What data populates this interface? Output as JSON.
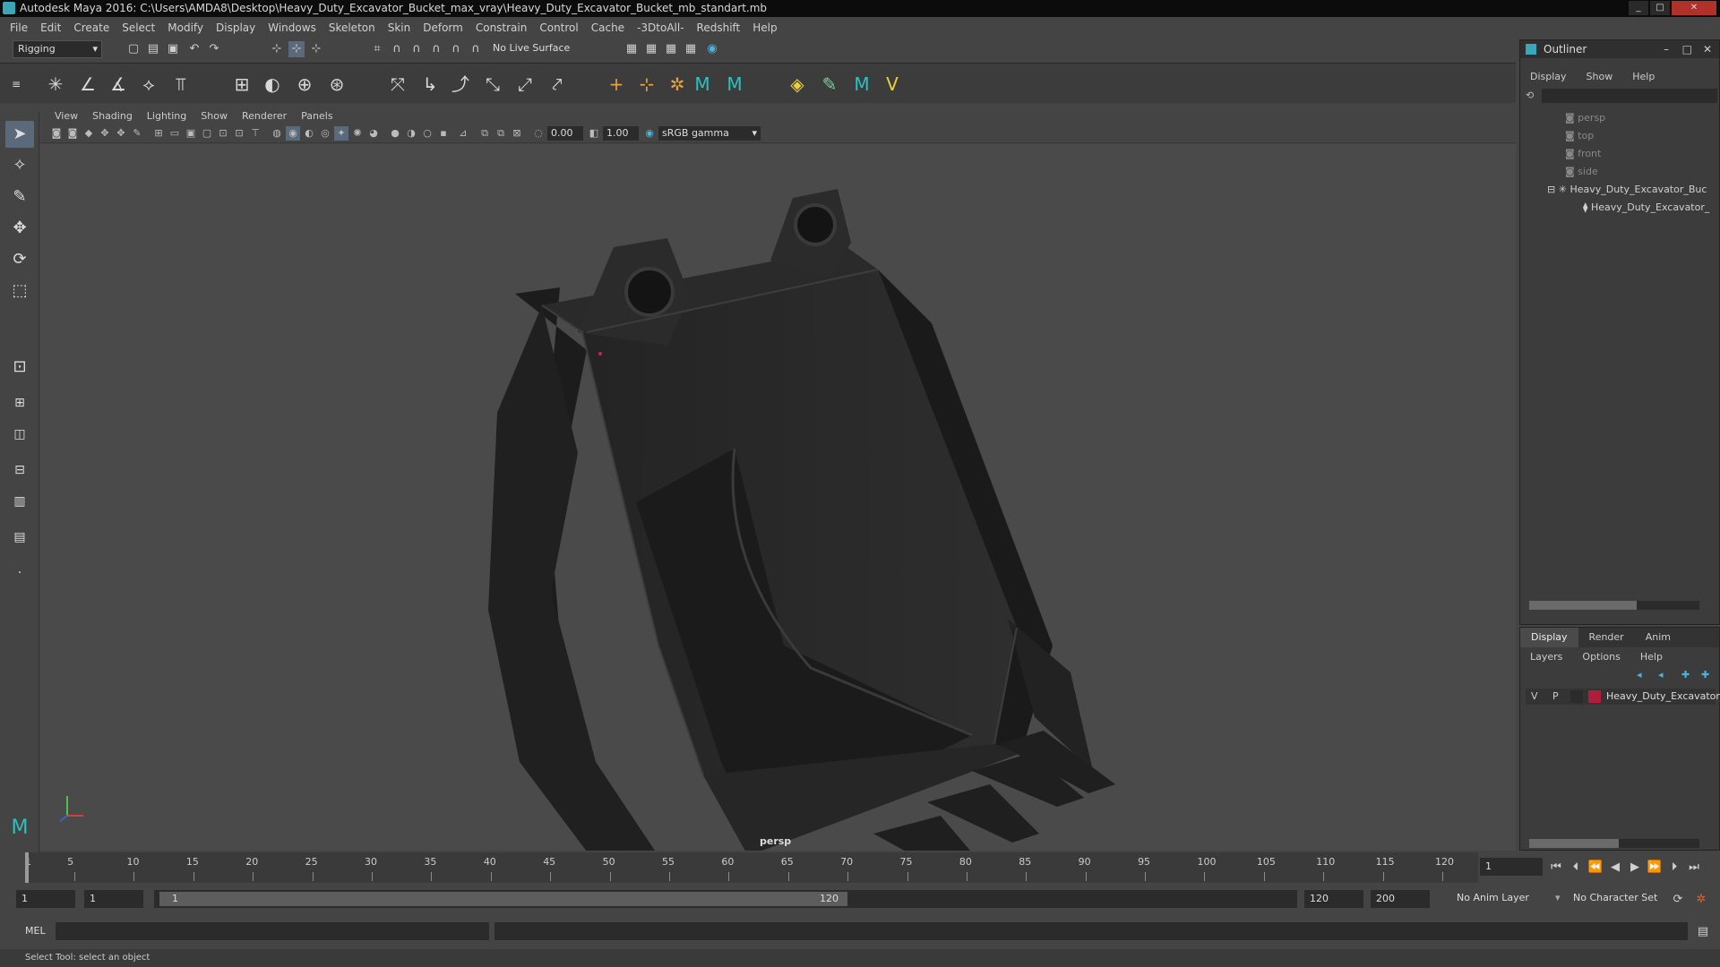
{
  "window": {
    "title": "Autodesk Maya 2016: C:\\Users\\AMDA8\\Desktop\\Heavy_Duty_Excavator_Bucket_max_vray\\Heavy_Duty_Excavator_Bucket_mb_standart.mb",
    "controls": [
      "_",
      "□",
      "✕"
    ]
  },
  "menubar": [
    "File",
    "Edit",
    "Create",
    "Select",
    "Modify",
    "Display",
    "Windows",
    "Skeleton",
    "Skin",
    "Deform",
    "Constrain",
    "Control",
    "Cache",
    "-3DtoAll-",
    "Redshift",
    "Help"
  ],
  "toolbar": {
    "menuset": "Rigging",
    "live_surface": "No Live Surface"
  },
  "viewport": {
    "menu": [
      "View",
      "Shading",
      "Lighting",
      "Show",
      "Renderer",
      "Panels"
    ],
    "exposure": "0.00",
    "gamma": "1.00",
    "color_space": "sRGB gamma",
    "camera_label": "persp"
  },
  "outliner": {
    "title": "Outliner",
    "menu": [
      "Display",
      "Show",
      "Help"
    ],
    "items": [
      {
        "label": "persp",
        "kind": "camera"
      },
      {
        "label": "top",
        "kind": "camera"
      },
      {
        "label": "front",
        "kind": "camera"
      },
      {
        "label": "side",
        "kind": "camera"
      },
      {
        "label": "Heavy_Duty_Excavator_Buc",
        "kind": "group"
      },
      {
        "label": "Heavy_Duty_Excavator_",
        "kind": "mesh"
      }
    ]
  },
  "layer_editor": {
    "tabs": [
      "Display",
      "Render",
      "Anim"
    ],
    "active_tab": "Display",
    "menu": [
      "Layers",
      "Options",
      "Help"
    ],
    "layer": {
      "v": "V",
      "p": "P",
      "name": "Heavy_Duty_Excavator_",
      "color": "#b01c3a"
    }
  },
  "timeline": {
    "ticks": [
      "1",
      "5",
      "10",
      "15",
      "20",
      "25",
      "30",
      "35",
      "40",
      "45",
      "50",
      "55",
      "60",
      "65",
      "70",
      "75",
      "80",
      "85",
      "90",
      "95",
      "100",
      "105",
      "110",
      "115",
      "120"
    ],
    "current_frame": "1"
  },
  "range": {
    "start": "1",
    "inner_start": "1",
    "slider_start": "1",
    "slider_end": "120",
    "end": "120",
    "outer_end": "200",
    "anim_layer": "No Anim Layer",
    "character_set": "No Character Set"
  },
  "command": {
    "label": "MEL"
  },
  "status": {
    "help_line": "Select Tool: select an object"
  },
  "colors": {
    "bucket": "#262626",
    "background": "#4a4a4a",
    "accent": "#3aa6b8"
  }
}
